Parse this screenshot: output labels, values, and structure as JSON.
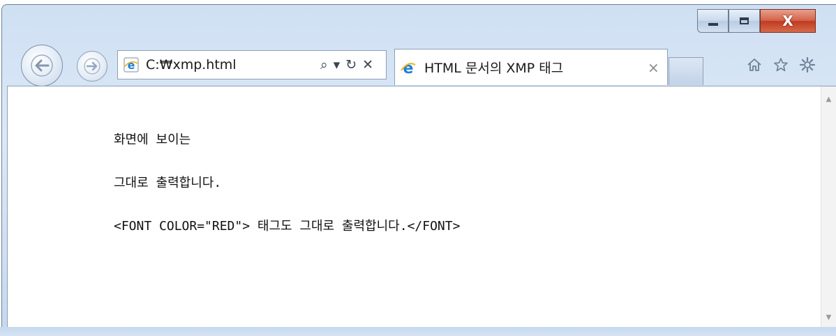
{
  "window": {
    "caption_buttons": {
      "minimize": "minimize",
      "maximize": "maximize",
      "close_glyph": "X"
    }
  },
  "navbar": {
    "address_text": "C:₩xmp.html",
    "address_tools": {
      "search_glyph": "⌕",
      "dropdown_glyph": "▾",
      "refresh_glyph": "↻",
      "stop_glyph": "✕"
    },
    "tab_title": "HTML 문서의 XMP 태그",
    "tab_close_glyph": "×"
  },
  "content": {
    "lines": [
      "화면에 보이는",
      "그대로 출력합니다.",
      "<FONT COLOR=\"RED\"> 태그도 그대로 출력합니다.</FONT>"
    ]
  },
  "colors": {
    "chrome": "#cfe0f3",
    "close_button": "#c13a1f",
    "ie_blue": "#1e7fd8"
  }
}
